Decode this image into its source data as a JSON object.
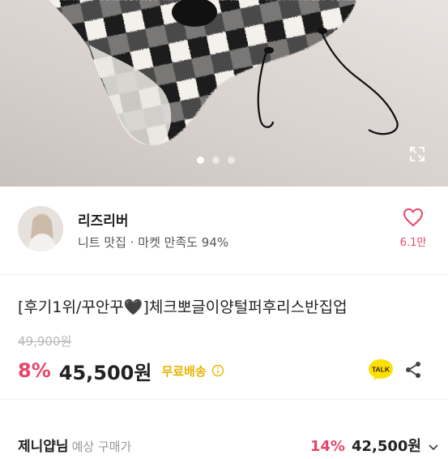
{
  "gallery": {
    "slide_count": 3,
    "active_slide": 1
  },
  "seller": {
    "name": "리즈리버",
    "subtitle": "니트 맛집 · 마켓 만족도 94%",
    "like_count": "6.1만"
  },
  "product": {
    "title": "[후기1위/꾸안꾸🖤]체크뽀글이양털퍼후리스반집업",
    "original_price": "49,900원",
    "discount": "8%",
    "price": "45,500원",
    "shipping": "무료배송"
  },
  "coupon_row": {
    "label": "제니얍님",
    "sub_label": "예상 구매가",
    "discount": "14%",
    "price": "42,500원"
  },
  "icons": {
    "expand": "expand-icon",
    "like": "heart-outline-icon",
    "info": "info-circle-icon",
    "kakaotalk": "kakaotalk-talk-icon",
    "share": "share-icon",
    "chevron": "chevron-down-icon"
  },
  "colors": {
    "accent_pink": "#e5476b",
    "shipping_yellow": "#e8b400",
    "kakao_yellow": "#fae100",
    "kakao_brown": "#3a1d1d"
  }
}
